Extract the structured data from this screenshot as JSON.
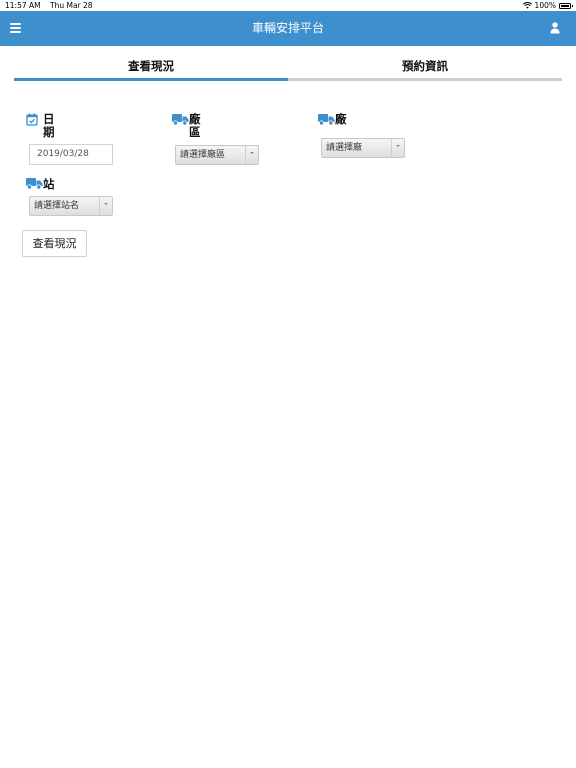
{
  "status_bar": {
    "time": "11:57 AM",
    "date": "Thu Mar 28",
    "battery": "100%"
  },
  "header": {
    "title": "車輛安排平台",
    "menu_icon": "hamburger-menu-icon",
    "user_icon": "user-icon"
  },
  "tabs": [
    {
      "label": "查看現況",
      "active": true
    },
    {
      "label": "預約資訊",
      "active": false
    }
  ],
  "form": {
    "date_label_line1": "日",
    "date_label_line2": "期",
    "date_value": "2019/03/28",
    "area_label_line1": "廠",
    "area_label_line2": "區",
    "area_select": "請選擇廠區",
    "plant_label": "廠",
    "plant_select": "請選擇廠",
    "station_label": "站",
    "station_select": "請選擇站名",
    "view_button": "查看現況"
  },
  "colors": {
    "accent": "#3d8fce",
    "header_bg": "#3d8fce",
    "tab_inactive": "#cfcfcf"
  }
}
